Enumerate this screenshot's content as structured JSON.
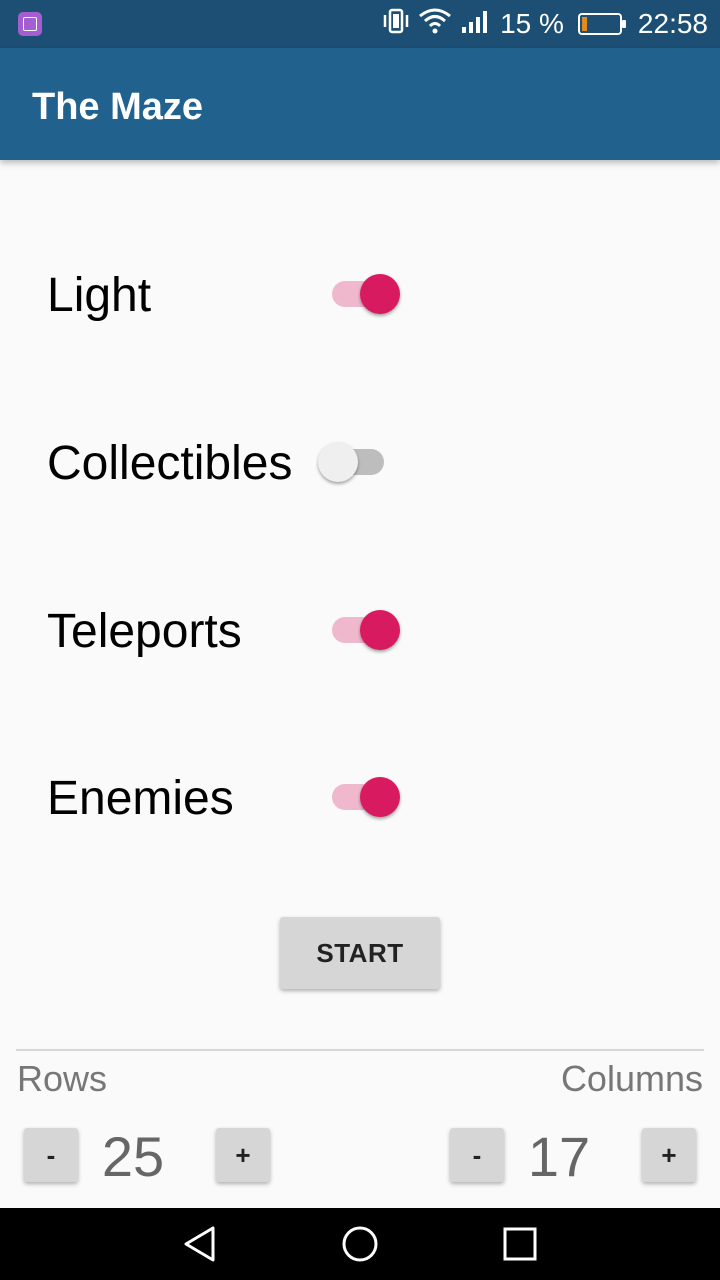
{
  "status_bar": {
    "battery_text": "15 %",
    "time": "22:58",
    "battery_level": 0.15,
    "battery_fill_color": "#e38a1e",
    "icons": [
      "app-icon",
      "vibrate-icon",
      "wifi-icon",
      "signal-icon",
      "battery-icon"
    ]
  },
  "app_bar": {
    "title": "The Maze",
    "color": "#21618e"
  },
  "options": [
    {
      "label": "Light",
      "checked": true
    },
    {
      "label": "Collectibles",
      "checked": false
    },
    {
      "label": "Teleports",
      "checked": true
    },
    {
      "label": "Enemies",
      "checked": true
    }
  ],
  "accent_color": "#d81b60",
  "start_button": {
    "label": "START"
  },
  "rows": {
    "label": "Rows",
    "value": "25",
    "minus": "-",
    "plus": "+"
  },
  "columns": {
    "label": "Columns",
    "value": "17",
    "minus": "-",
    "plus": "+"
  },
  "nav_bar": {
    "icons": [
      "back-icon",
      "home-icon",
      "recents-icon"
    ]
  }
}
